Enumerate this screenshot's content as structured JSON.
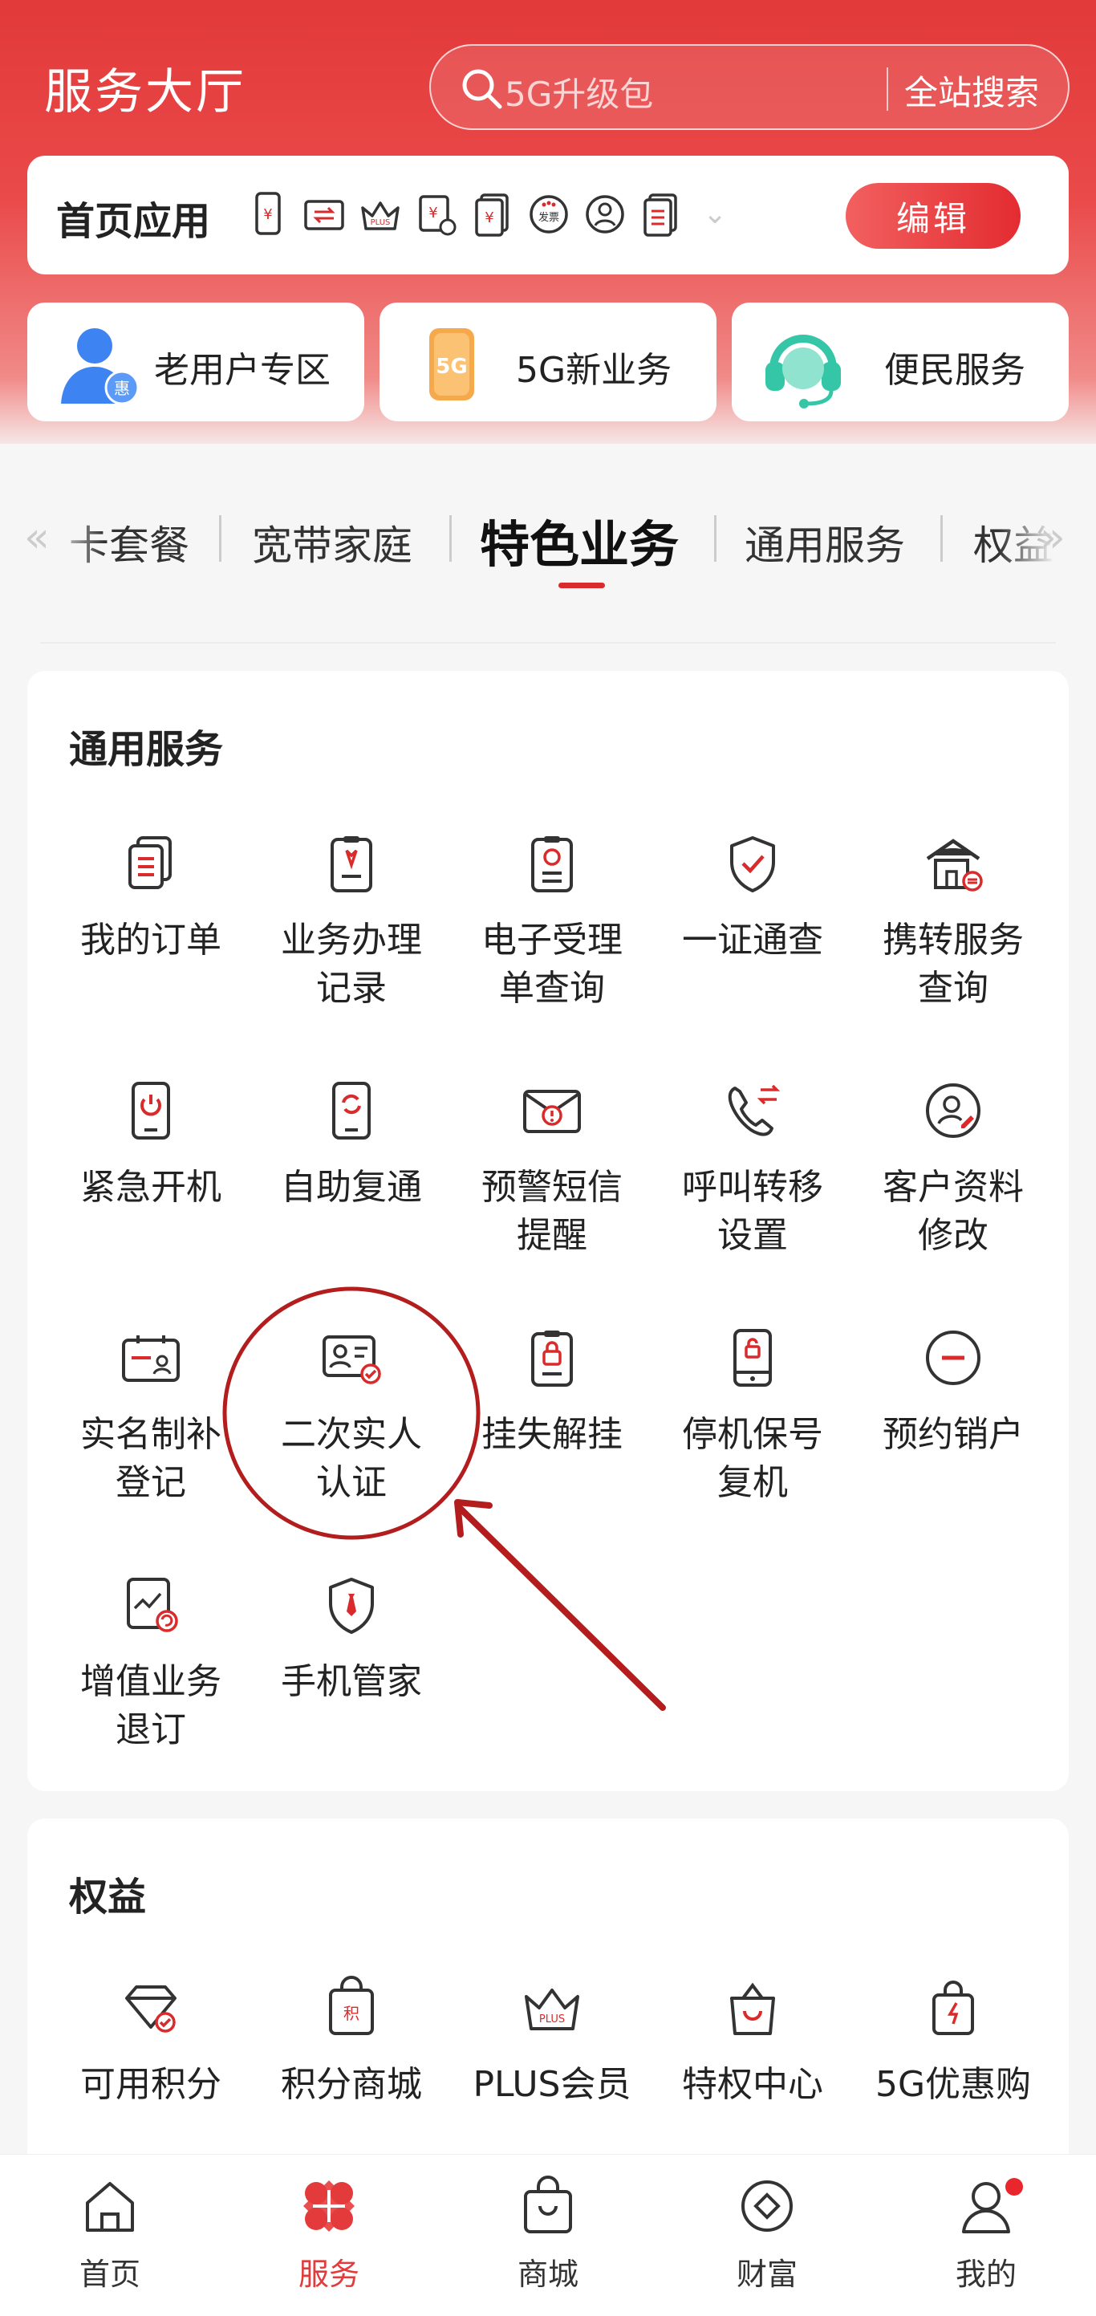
{
  "header": {
    "title": "服务大厅",
    "search_placeholder": "5G升级包",
    "search_button": "全站搜索"
  },
  "quick_apps": {
    "label": "首页应用",
    "icons": [
      "phone-bill-icon",
      "transfer-icon",
      "plus-crown-icon",
      "bill-clock-icon",
      "yuan-doc-icon",
      "invoice-icon",
      "user-circle-icon",
      "list-doc-icon"
    ],
    "edit_label": "编辑"
  },
  "feature_cards": [
    {
      "label": "老用户专区",
      "icon": "old-user-icon"
    },
    {
      "label": "5G新业务",
      "icon": "5g-card-icon"
    },
    {
      "label": "便民服务",
      "icon": "headset-icon"
    }
  ],
  "categories": {
    "items": [
      "卡套餐",
      "宽带家庭",
      "特色业务",
      "通用服务",
      "权益"
    ],
    "active": "特色业务"
  },
  "general_services": {
    "title": "通用服务",
    "items": [
      {
        "label": "我的订单",
        "icon": "orders-icon"
      },
      {
        "label": "业务办理记录",
        "icon": "handling-record-icon"
      },
      {
        "label": "电子受理单查询",
        "icon": "e-receipt-icon"
      },
      {
        "label": "一证通查",
        "icon": "shield-check-icon"
      },
      {
        "label": "携转服务查询",
        "icon": "number-transfer-icon"
      },
      {
        "label": "紧急开机",
        "icon": "power-phone-icon"
      },
      {
        "label": "自助复通",
        "icon": "restore-phone-icon"
      },
      {
        "label": "预警短信提醒",
        "icon": "alert-sms-icon"
      },
      {
        "label": "呼叫转移设置",
        "icon": "call-forward-icon"
      },
      {
        "label": "客户资料修改",
        "icon": "profile-edit-icon"
      },
      {
        "label": "实名制补登记",
        "icon": "realname-register-icon"
      },
      {
        "label": "二次实人认证",
        "icon": "id-card-verify-icon"
      },
      {
        "label": "挂失解挂",
        "icon": "lock-clipboard-icon"
      },
      {
        "label": "停机保号复机",
        "icon": "suspend-phone-icon"
      },
      {
        "label": "预约销户",
        "icon": "minus-circle-icon"
      },
      {
        "label": "增值业务退订",
        "icon": "unsubscribe-icon"
      },
      {
        "label": "手机管家",
        "icon": "phone-guard-icon"
      }
    ]
  },
  "rights": {
    "title": "权益",
    "items": [
      {
        "label": "可用积分",
        "icon": "points-diamond-icon"
      },
      {
        "label": "积分商城",
        "icon": "points-mall-icon"
      },
      {
        "label": "PLUS会员",
        "icon": "plus-member-icon"
      },
      {
        "label": "特权中心",
        "icon": "privilege-bag-icon"
      },
      {
        "label": "5G优惠购",
        "icon": "5g-shopping-icon"
      }
    ]
  },
  "bottom_nav": {
    "items": [
      {
        "label": "首页",
        "icon": "home-icon"
      },
      {
        "label": "服务",
        "icon": "services-icon"
      },
      {
        "label": "商城",
        "icon": "shop-bag-icon"
      },
      {
        "label": "财富",
        "icon": "wealth-icon"
      },
      {
        "label": "我的",
        "icon": "profile-icon"
      }
    ],
    "active": "服务"
  },
  "colors": {
    "brand_red": "#e33b3b",
    "icon_red": "#d92b2b",
    "annotation": "#b31d1d"
  }
}
